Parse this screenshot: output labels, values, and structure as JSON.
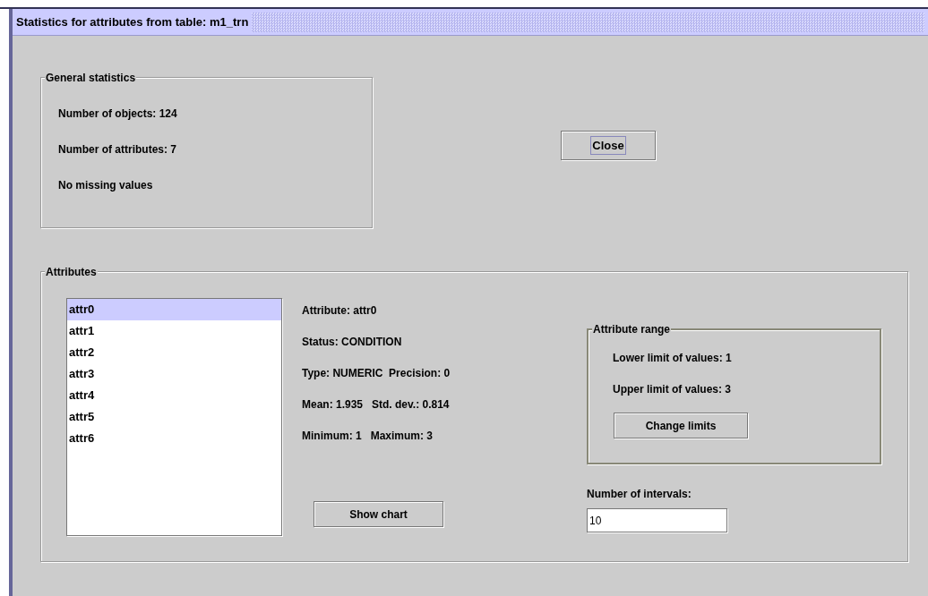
{
  "window": {
    "title": "Statistics for attributes from table: m1_trn"
  },
  "general_statistics": {
    "title": "General statistics",
    "lines": [
      "Number of objects: 124",
      "Number of attributes: 7",
      "No missing values"
    ]
  },
  "close_button": {
    "label": "Close",
    "focused": true
  },
  "attributes": {
    "title": "Attributes",
    "list": [
      {
        "label": "attr0",
        "selected": true
      },
      {
        "label": "attr1",
        "selected": false
      },
      {
        "label": "attr2",
        "selected": false
      },
      {
        "label": "attr3",
        "selected": false
      },
      {
        "label": "attr4",
        "selected": false
      },
      {
        "label": "attr5",
        "selected": false
      },
      {
        "label": "attr6",
        "selected": false
      }
    ],
    "details": [
      "Attribute: attr0",
      "Status: CONDITION",
      "Type: NUMERIC  Precision: 0",
      "Mean: 1.935   Std. dev.: 0.814",
      "Minimum: 1   Maximum: 3"
    ],
    "show_chart_button": "Show chart",
    "attribute_range": {
      "title": "Attribute range",
      "lines": [
        "Lower limit of values: 1",
        "Upper limit of values: 3"
      ],
      "button": "Change limits"
    },
    "intervals": {
      "label": "Number of intervals:",
      "value": "10"
    }
  }
}
